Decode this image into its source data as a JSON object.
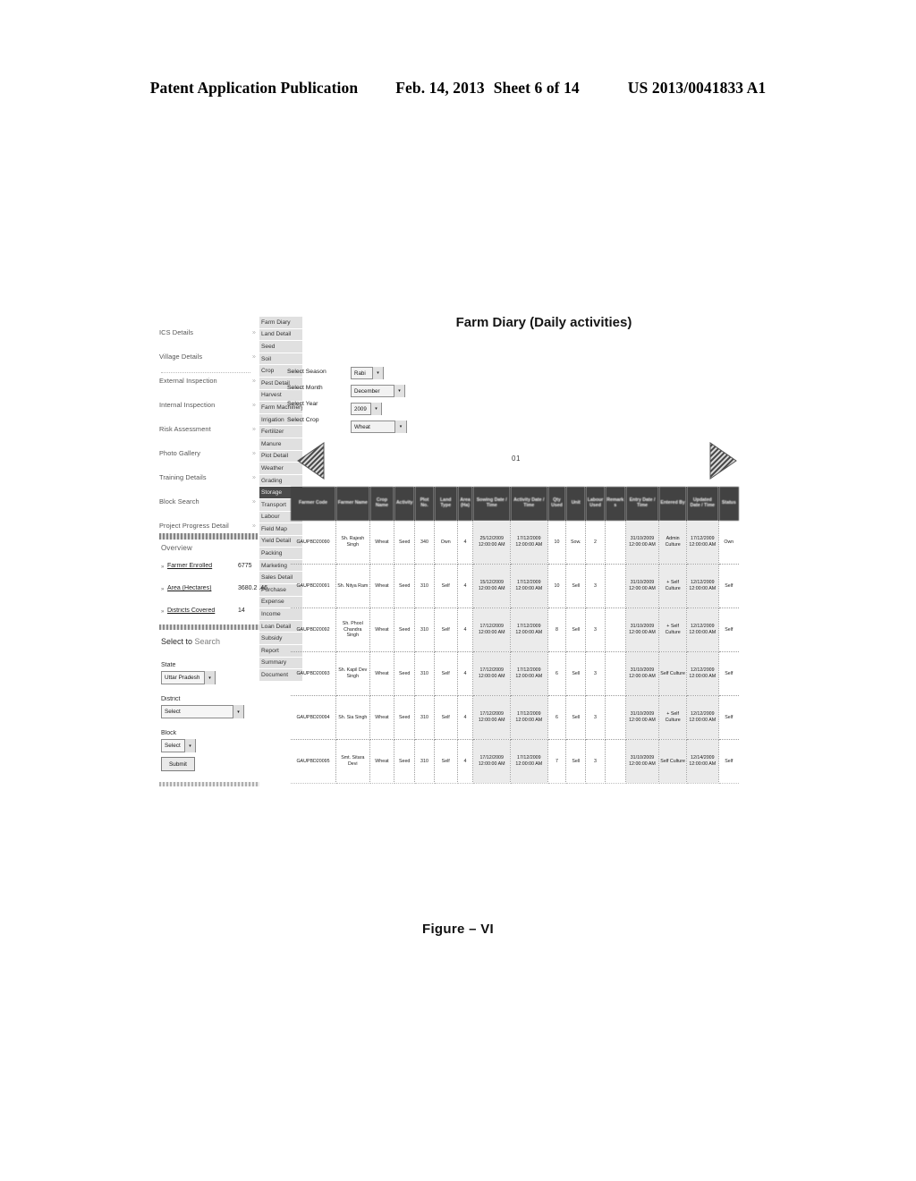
{
  "patent_header": {
    "publication": "Patent Application Publication",
    "date": "Feb. 14, 2013",
    "sheet": "Sheet 6 of 14",
    "number": "US 2013/0041833 A1"
  },
  "figure_caption": "Figure – VI",
  "app": {
    "title": "Farm Diary (Daily activities)",
    "page_indicator": "01",
    "prev_arrow_icon": "triangle-left-icon",
    "next_arrow_icon": "triangle-right-icon"
  },
  "nav": {
    "items": [
      {
        "label": "ICS Details",
        "expander": "»"
      },
      {
        "label": "Village Details",
        "expander": "»"
      },
      {
        "label": "External Inspection",
        "expander": "»"
      },
      {
        "label": "Internal Inspection",
        "expander": "»"
      },
      {
        "label": "Risk Assessment",
        "expander": "»"
      },
      {
        "label": "Photo Gallery",
        "expander": "»"
      },
      {
        "label": "Training Details",
        "expander": "»"
      },
      {
        "label": "Block Search",
        "expander": "»"
      },
      {
        "label": "Project Progress Detail",
        "expander": "»"
      }
    ]
  },
  "submenu": {
    "items": [
      {
        "label": "Farm Diary",
        "active": false
      },
      {
        "label": "Land Detail",
        "active": false
      },
      {
        "label": "Seed",
        "active": false
      },
      {
        "label": "Soil",
        "active": false
      },
      {
        "label": "Crop",
        "active": false
      },
      {
        "label": "Pest Detail",
        "active": false
      },
      {
        "label": "Harvest",
        "active": false
      },
      {
        "label": "Farm Machinery",
        "active": false
      },
      {
        "label": "Irrigation",
        "active": false
      },
      {
        "label": "Fertilizer",
        "active": false
      },
      {
        "label": "Manure",
        "active": false
      },
      {
        "label": "Plot Detail",
        "active": false
      },
      {
        "label": "Weather",
        "active": false
      },
      {
        "label": "Grading",
        "active": false
      },
      {
        "label": "Storage",
        "active": true
      },
      {
        "label": "Transport",
        "active": false
      },
      {
        "label": "Labour",
        "active": false
      },
      {
        "label": "Field Map",
        "active": false
      },
      {
        "label": "Yield Detail",
        "active": false
      },
      {
        "label": "Packing",
        "active": false
      },
      {
        "label": "Marketing",
        "active": false
      },
      {
        "label": "Sales Detail",
        "active": false
      },
      {
        "label": "Purchase",
        "active": false
      },
      {
        "label": "Expense",
        "active": false
      },
      {
        "label": "Income",
        "active": false
      },
      {
        "label": "Loan Detail",
        "active": false
      },
      {
        "label": "Subsidy",
        "active": false
      },
      {
        "label": "Report",
        "active": false
      },
      {
        "label": "Summary",
        "active": false
      },
      {
        "label": "Document",
        "active": false
      }
    ]
  },
  "filters": {
    "rows": [
      {
        "label": "Select Season",
        "value": "Rabi"
      },
      {
        "label": "Select Month",
        "value": "December"
      },
      {
        "label": "Select Year",
        "value": "2009"
      },
      {
        "label": "Select Crop",
        "value": "Wheat"
      }
    ],
    "caret_icon": "▾"
  },
  "overview": {
    "title": "Overview",
    "stats": [
      {
        "bullet": "»",
        "label": "Farmer Enrolled",
        "value": "6775"
      },
      {
        "bullet": "»",
        "label": "Area (Hectares)",
        "value": "3680.2 .46"
      },
      {
        "bullet": "»",
        "label": "Districts Covered",
        "value": "14"
      }
    ]
  },
  "search_panel": {
    "title_word1": "Select to",
    "title_word2": "Search",
    "state_label": "State",
    "state_value": "Uttar Pradesh",
    "district_label": "District",
    "district_value": "Select",
    "block_label": "Block",
    "block_value": "Select",
    "submit_label": "Submit",
    "caret_icon": "▾"
  },
  "table": {
    "headers": [
      "Farmer Code",
      "Farmer Name",
      "Crop Name",
      "Activity",
      "Plot No.",
      "Land Type",
      "Area (Ha)",
      "Sowing Date / Time",
      "Activity Date / Time",
      "Qty Used",
      "Unit",
      "Labour Used",
      "Remarks",
      "Entry Date / Time",
      "Entered By",
      "Updated Date / Time",
      "Status"
    ],
    "rows": [
      {
        "farmer_code": "GAUPBD20090",
        "farmer_name": "Sh. Rajesh Singh",
        "crop": "Wheat",
        "activity": "Seed",
        "plot_no": "340",
        "land_type": "Own",
        "area": "4",
        "sowing": "25/12/2009 12:00:00 AM",
        "activity_date": "17/12/2009 12:00:00 AM",
        "qty": "10",
        "unit": "Sow.",
        "labour": "2",
        "remarks": "",
        "entry": "31/10/2009 12:00:00 AM",
        "entered_by": "Admin Culture",
        "updated": "17/12/2009 12:00:00 AM",
        "status": "Own"
      },
      {
        "farmer_code": "GAUPBD20091",
        "farmer_name": "Sh. Nitya Ram",
        "crop": "Wheat",
        "activity": "Seed",
        "plot_no": "310",
        "land_type": "Self",
        "area": "4",
        "sowing": "15/12/2009 12:00:00 AM",
        "activity_date": "17/12/2009 12:00:00 AM",
        "qty": "10",
        "unit": "Sell",
        "labour": "3",
        "remarks": "",
        "entry": "31/10/2009 12:00:00 AM",
        "entered_by": "+ Self Culture",
        "updated": "12/12/2009 12:00:00 AM",
        "status": "Self"
      },
      {
        "farmer_code": "GAUPBD20092",
        "farmer_name": "Sh. Phool Chandra Singh",
        "crop": "Wheat",
        "activity": "Seed",
        "plot_no": "310",
        "land_type": "Self",
        "area": "4",
        "sowing": "17/12/2009 12:00:00 AM",
        "activity_date": "17/12/2009 12:00:00 AM",
        "qty": "8",
        "unit": "Sell",
        "labour": "3",
        "remarks": "",
        "entry": "31/10/2009 12:00:00 AM",
        "entered_by": "+ Self Culture",
        "updated": "12/12/2009 12:00:00 AM",
        "status": "Self"
      },
      {
        "farmer_code": "GAUPBD20093",
        "farmer_name": "Sh. Kapil Dev Singh",
        "crop": "Wheat",
        "activity": "Seed",
        "plot_no": "310",
        "land_type": "Self",
        "area": "4",
        "sowing": "17/12/2009 12:00:00 AM",
        "activity_date": "17/12/2009 12:00:00 AM",
        "qty": "6",
        "unit": "Sell",
        "labour": "3",
        "remarks": "",
        "entry": "31/10/2009 12:00:00 AM",
        "entered_by": "Self Culture",
        "updated": "12/12/2009 12:00:00 AM",
        "status": "Self"
      },
      {
        "farmer_code": "GAUPBD20094",
        "farmer_name": "Sh. Sia Singh",
        "crop": "Wheat",
        "activity": "Seed",
        "plot_no": "310",
        "land_type": "Self",
        "area": "4",
        "sowing": "17/12/2009 12:00:00 AM",
        "activity_date": "17/12/2009 12:00:00 AM",
        "qty": "6",
        "unit": "Sell",
        "labour": "3",
        "remarks": "",
        "entry": "31/10/2009 12:00:00 AM",
        "entered_by": "+ Self Culture",
        "updated": "12/12/2009 12:00:00 AM",
        "status": "Self"
      },
      {
        "farmer_code": "GAUPBD20095",
        "farmer_name": "Smt. Sitara Devi",
        "crop": "Wheat",
        "activity": "Seed",
        "plot_no": "310",
        "land_type": "Self",
        "area": "4",
        "sowing": "17/12/2009 12:00:00 AM",
        "activity_date": "17/12/2009 12:00:00 AM",
        "qty": "7",
        "unit": "Sell",
        "labour": "3",
        "remarks": "",
        "entry": "31/10/2009 12:00:00 AM",
        "entered_by": "Self Culture",
        "updated": "12/14/2009 12:00:00 AM",
        "status": "Self"
      }
    ]
  }
}
